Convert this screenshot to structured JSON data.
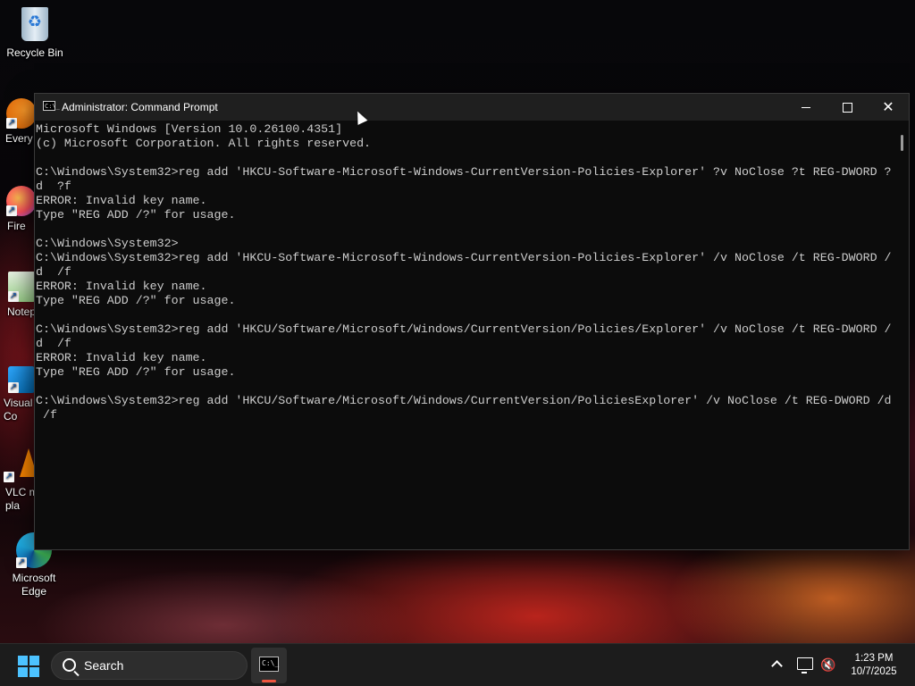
{
  "desktop": {
    "icons": [
      {
        "label": "Recycle Bin"
      },
      {
        "label": "Every"
      },
      {
        "label": "Fire"
      },
      {
        "label": "Notep"
      },
      {
        "label": "Visual\nCo"
      },
      {
        "label": "VLC m\npla"
      },
      {
        "label": "Microsoft\nEdge"
      }
    ]
  },
  "window": {
    "title": "Administrator: Command Prompt",
    "icon_text": "C:\\_",
    "minimize_icon": "minimize-icon",
    "maximize_icon": "maximize-icon",
    "close_glyph": "✕"
  },
  "console": {
    "lines": [
      "Microsoft Windows [Version 10.0.26100.4351]",
      "(c) Microsoft Corporation. All rights reserved.",
      "",
      "C:\\Windows\\System32>reg add 'HKCU-Software-Microsoft-Windows-CurrentVersion-Policies-Explorer' ?v NoClose ?t REG-DWORD ?",
      "d  ?f",
      "ERROR: Invalid key name.",
      "Type \"REG ADD /?\" for usage.",
      "",
      "C:\\Windows\\System32>",
      "C:\\Windows\\System32>reg add 'HKCU-Software-Microsoft-Windows-CurrentVersion-Policies-Explorer' /v NoClose /t REG-DWORD /",
      "d  /f",
      "ERROR: Invalid key name.",
      "Type \"REG ADD /?\" for usage.",
      "",
      "C:\\Windows\\System32>reg add 'HKCU/Software/Microsoft/Windows/CurrentVersion/Policies/Explorer' /v NoClose /t REG-DWORD /",
      "d  /f",
      "ERROR: Invalid key name.",
      "Type \"REG ADD /?\" for usage.",
      "",
      "C:\\Windows\\System32>reg add 'HKCU/Software/Microsoft/Windows/CurrentVersion/PoliciesExplorer' /v NoClose /t REG-DWORD /d",
      " /f"
    ]
  },
  "taskbar": {
    "search_label": "Search",
    "cmd_icon_text": "C:\\_",
    "volume_glyph": "🔇",
    "time": "1:23 PM",
    "date": "10/7/2025"
  },
  "colors": {
    "console_bg": "#0c0c0c",
    "console_fg": "#cccccc",
    "titlebar_bg": "#1f1f1f",
    "taskbar_bg": "#1c1c1c",
    "start_accent": "#4cc2ff",
    "active_indicator": "#f0553f"
  }
}
